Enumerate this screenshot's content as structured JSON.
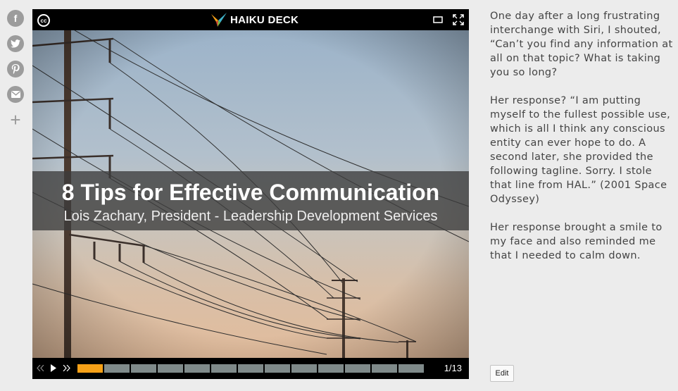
{
  "share": {
    "facebook_glyph": "f",
    "plus_glyph": "+"
  },
  "player": {
    "cc_label": "cc",
    "brand": "HAIKU DECK",
    "slide": {
      "title": "8 Tips for Effective Communication",
      "subtitle": "Lois Zachary, President - Leadership Development Services"
    },
    "counter": "1/13",
    "progress": {
      "current": 1,
      "total": 13
    },
    "colors": {
      "progress_active": "#f5a017",
      "progress_inactive": "#7f8a8a"
    }
  },
  "description": {
    "paragraphs": [
      "One day after a long frustrating interchange with Siri, I shouted, “Can’t you find any information at all on that topic? What is taking you so long?",
      "Her response? “I am putting myself to the fullest possible use, which is all I think any conscious entity can ever hope to do. A second later, she provided the following tagline. Sorry. I stole that line from HAL.” (2001 Space Odyssey)",
      "Her response brought a smile to my face and also reminded me that I needed to calm down."
    ]
  },
  "edit_label": "Edit"
}
